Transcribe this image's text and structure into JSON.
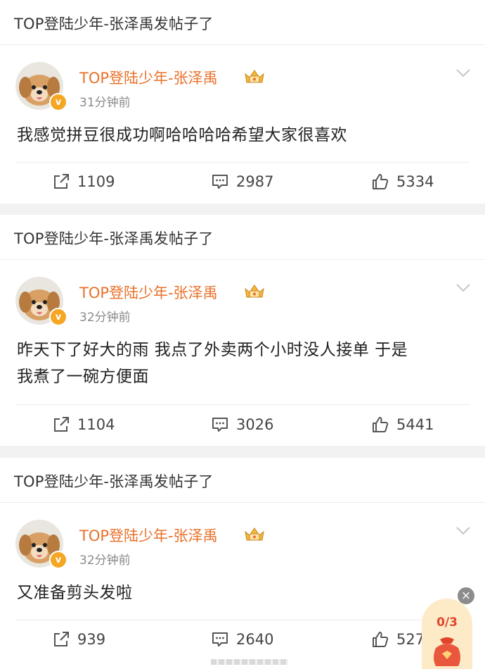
{
  "posts": [
    {
      "header_title": "TOP登陆少年-张泽禹发帖子了",
      "username": "TOP登陆少年-张泽禹",
      "timestamp": "31分钟前",
      "content": "我感觉拼豆很成功啊哈哈哈哈希望大家很喜欢",
      "repost_count": "1109",
      "comment_count": "2987",
      "like_count": "5334"
    },
    {
      "header_title": "TOP登陆少年-张泽禹发帖子了",
      "username": "TOP登陆少年-张泽禹",
      "timestamp": "32分钟前",
      "content_line1": "昨天下了好大的雨 我点了外卖两个小时没人接单 于是",
      "content_line2": "我煮了一碗方便面",
      "repost_count": "1104",
      "comment_count": "3026",
      "like_count": "5441"
    },
    {
      "header_title": "TOP登陆少年-张泽禹发帖子了",
      "username": "TOP登陆少年-张泽禹",
      "timestamp": "32分钟前",
      "content": "又准备剪头发啦",
      "repost_count": "939",
      "comment_count": "2640",
      "like_count": "527"
    }
  ],
  "floating_widget": {
    "count": "0/3",
    "close_symbol": "×"
  },
  "verified_mark": "v",
  "colors": {
    "username": "#e8712a",
    "background": "#f2f2f2",
    "badge": "#f5a623"
  },
  "icons": [
    "avatar-dog-icon",
    "crown-badge-icon",
    "chevron-down-icon",
    "repost-icon",
    "comment-icon",
    "like-icon",
    "red-packet-icon"
  ]
}
